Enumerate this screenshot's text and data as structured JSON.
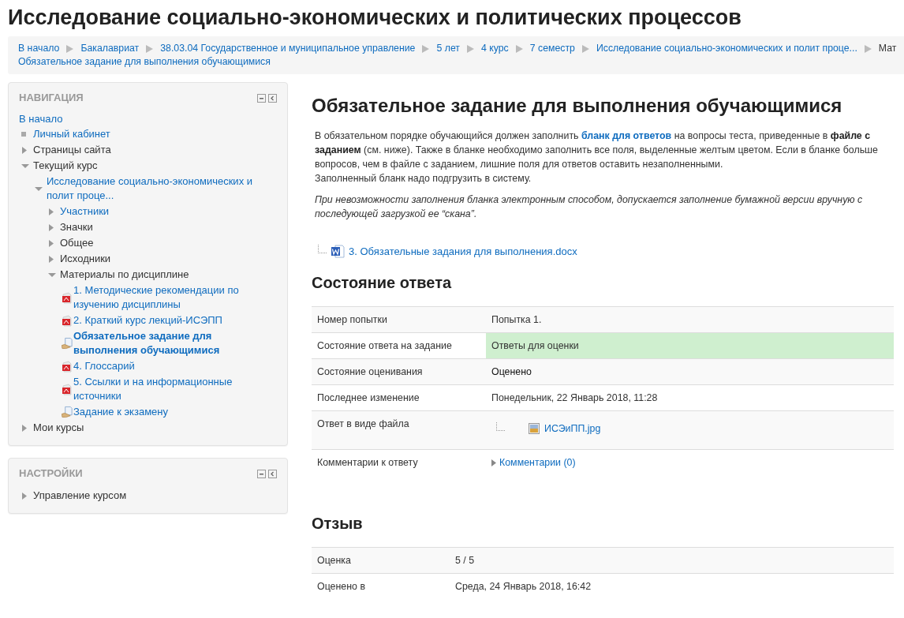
{
  "page_title": "Исследование социально-экономических и политических процессов",
  "breadcrumb": {
    "items": [
      {
        "label": "В начало",
        "link": true
      },
      {
        "label": "Бакалавриат",
        "link": true
      },
      {
        "label": "38.03.04 Государственное и муниципальное управление",
        "link": true
      },
      {
        "label": "5 лет",
        "link": true
      },
      {
        "label": "4 курс",
        "link": true
      },
      {
        "label": "7 семестр",
        "link": true
      },
      {
        "label": "Исследование социально-экономических и полит проце...",
        "link": true
      },
      {
        "label": "Мат",
        "link": false
      }
    ],
    "current": {
      "label": "Обязательное задание для выполнения обучающимися",
      "link": true
    }
  },
  "navigation": {
    "title": "НАВИГАЦИЯ",
    "home": {
      "label": "В начало",
      "link": true
    },
    "items": [
      {
        "label": "Личный кабинет",
        "kind": "leaf",
        "link": true
      },
      {
        "label": "Страницы сайта",
        "kind": "branch",
        "expanded": false,
        "link": false
      },
      {
        "label": "Текущий курс",
        "kind": "branch",
        "expanded": true,
        "link": false,
        "children": [
          {
            "label": "Исследование социально-экономических и полит проце...",
            "kind": "branch",
            "expanded": true,
            "link": true,
            "children": [
              {
                "label": "Участники",
                "kind": "branch",
                "expanded": false,
                "link": true
              },
              {
                "label": "Значки",
                "kind": "branch",
                "expanded": false,
                "link": false
              },
              {
                "label": "Общее",
                "kind": "branch",
                "expanded": false,
                "link": false
              },
              {
                "label": "Исходники",
                "kind": "branch",
                "expanded": false,
                "link": false
              },
              {
                "label": "Материалы по дисциплине",
                "kind": "branch",
                "expanded": true,
                "link": false,
                "children": [
                  {
                    "label": "1. Методические рекомендации по изучению дисциплины",
                    "kind": "pdf",
                    "link": true,
                    "selected": false
                  },
                  {
                    "label": "2. Краткий курс лекций-ИСЭПП",
                    "kind": "pdf",
                    "link": true,
                    "selected": false
                  },
                  {
                    "label": "Обязательное задание для выполнения обучающимися",
                    "kind": "assign",
                    "link": true,
                    "selected": true
                  },
                  {
                    "label": "4. Глоссарий",
                    "kind": "pdf",
                    "link": true,
                    "selected": false
                  },
                  {
                    "label": "5. Ссылки и на информационные источники",
                    "kind": "pdf",
                    "link": true,
                    "selected": false
                  },
                  {
                    "label": "Задание к экзамену",
                    "kind": "assign",
                    "link": true,
                    "selected": false
                  }
                ]
              }
            ]
          }
        ]
      },
      {
        "label": "Мои курсы",
        "kind": "branch",
        "expanded": false,
        "link": false
      }
    ]
  },
  "settings": {
    "title": "НАСТРОЙКИ",
    "items": [
      {
        "label": "Управление курсом",
        "kind": "branch",
        "expanded": false,
        "link": false
      }
    ]
  },
  "assignment": {
    "title": "Обязательное задание для выполнения обучающимися",
    "intro": [
      {
        "kind": "plain",
        "segments": [
          {
            "kind": "text",
            "text": "В обязательном порядке обучающийся должен заполнить "
          },
          {
            "kind": "link",
            "text": "бланк для ответов"
          },
          {
            "kind": "text",
            "text": " на вопросы теста, приведенные в "
          },
          {
            "kind": "bold",
            "text": "файле с заданием"
          },
          {
            "kind": "text",
            "text": " (см. ниже). Также в бланке необходимо заполнить все поля, выделенные желтым цветом. Если в бланке больше вопросов, чем в файле с заданием, лишние поля для ответов оставить незаполненными."
          },
          {
            "kind": "break"
          },
          {
            "kind": "text",
            "text": "Заполненный бланк надо подгрузить в систему."
          }
        ]
      },
      {
        "kind": "italic",
        "segments": [
          {
            "kind": "text",
            "text": "При невозможности заполнения бланка электронным способом, допускается заполнение бумажной версии вручную с последующей загрузкой ее “скана”."
          }
        ]
      }
    ],
    "file": "3. Обязательные задания для выполнения.docx"
  },
  "sections": [
    {
      "title": "Состояние ответа",
      "rows": [
        {
          "label": "Номер попытки",
          "kind": "text",
          "value": "Попытка 1."
        },
        {
          "label": "Состояние ответа на задание",
          "kind": "submitted",
          "value": "Ответы для оценки"
        },
        {
          "label": "Состояние оценивания",
          "kind": "graded",
          "value": "Оценено"
        },
        {
          "label": "Последнее изменение",
          "kind": "text",
          "value": "Понедельник, 22 Январь 2018, 11:28"
        },
        {
          "label": "Ответ в виде файла",
          "kind": "file",
          "value": "ИСЭиПП.jpg"
        },
        {
          "label": "Комментарии к ответу",
          "kind": "comments",
          "value": "Комментарии (0)"
        }
      ]
    },
    {
      "title": "Отзыв",
      "rows": [
        {
          "label": "Оценка",
          "kind": "text",
          "value": "5 / 5"
        },
        {
          "label": "Оценено в",
          "kind": "text",
          "value": "Среда, 24 Январь 2018, 16:42"
        }
      ]
    }
  ]
}
